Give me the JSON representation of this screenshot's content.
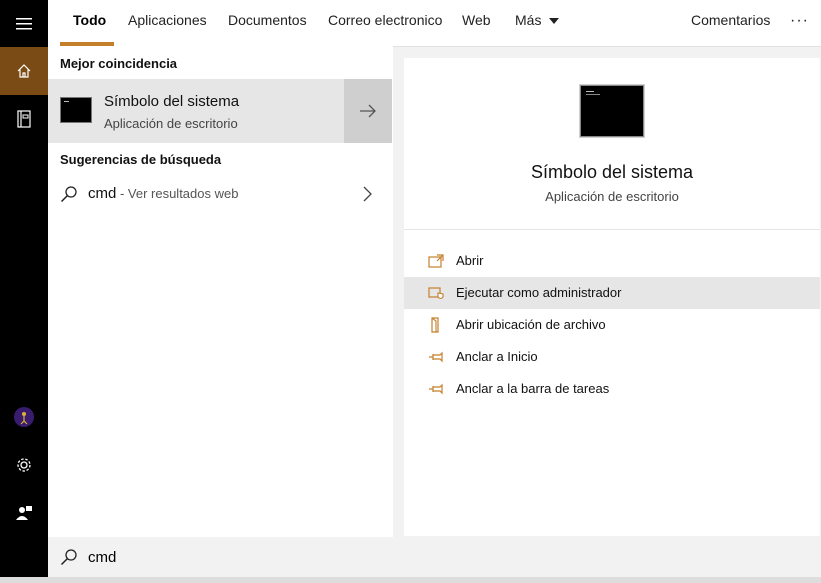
{
  "rail": {
    "items": [
      {
        "icon": "hamburger-menu-icon"
      },
      {
        "icon": "home-icon",
        "active": true
      },
      {
        "icon": "notebook-icon"
      },
      {
        "icon": "user-avatar-icon"
      },
      {
        "icon": "gear-icon"
      },
      {
        "icon": "feedback-person-icon"
      }
    ],
    "active_color": "#7a4b14"
  },
  "tabs": {
    "items": [
      "Todo",
      "Aplicaciones",
      "Documentos",
      "Correo electronico",
      "Web",
      "Más"
    ],
    "active": "Todo",
    "feedback": "Comentarios",
    "more_icon": "ellipsis-icon",
    "accent": "#c47f2b"
  },
  "results": {
    "best_match_heading": "Mejor coincidencia",
    "best_match": {
      "title": "Símbolo del sistema",
      "subtitle": "Aplicación de escritorio",
      "icon": "terminal-icon"
    },
    "suggestions_heading": "Sugerencias de búsqueda",
    "suggestion": {
      "query": "cmd",
      "suffix": " - Ver resultados web"
    }
  },
  "detail": {
    "title": "Símbolo del sistema",
    "subtitle": "Aplicación de escritorio",
    "actions": [
      {
        "label": "Abrir",
        "icon": "open-window-icon"
      },
      {
        "label": "Ejecutar como administrador",
        "icon": "shield-run-icon",
        "hover": true
      },
      {
        "label": "Abrir ubicación de archivo",
        "icon": "file-location-icon"
      },
      {
        "label": "Anclar a Inicio",
        "icon": "pin-icon"
      },
      {
        "label": "Anclar a la barra de tareas",
        "icon": "pin-icon"
      }
    ],
    "icon_color": "#c47f2b"
  },
  "search": {
    "value": "cmd",
    "icon": "search-icon"
  }
}
